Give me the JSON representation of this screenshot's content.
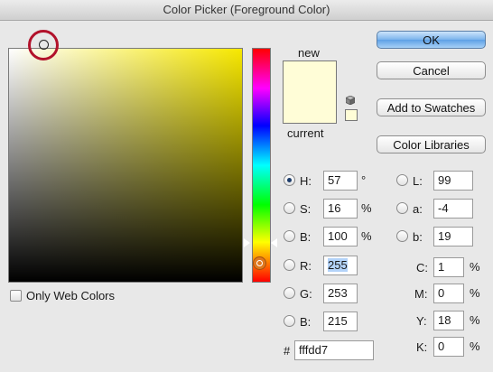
{
  "window": {
    "title": "Color Picker (Foreground Color)"
  },
  "swatches": {
    "new_label": "new",
    "current_label": "current",
    "new_color": "#fffdd7",
    "current_color": "#fffdd7"
  },
  "buttons": {
    "ok": "OK",
    "cancel": "Cancel",
    "add_to_swatches": "Add to Swatches",
    "color_libraries": "Color Libraries"
  },
  "only_web_colors": {
    "label": "Only Web Colors",
    "checked": false
  },
  "hsb": {
    "h": {
      "label": "H:",
      "value": "57",
      "unit": "°"
    },
    "s": {
      "label": "S:",
      "value": "16",
      "unit": "%"
    },
    "b": {
      "label": "B:",
      "value": "100",
      "unit": "%"
    }
  },
  "lab": {
    "l": {
      "label": "L:",
      "value": "99"
    },
    "a": {
      "label": "a:",
      "value": "-4"
    },
    "b": {
      "label": "b:",
      "value": "19"
    }
  },
  "rgb": {
    "r": {
      "label": "R:",
      "value": "255"
    },
    "g": {
      "label": "G:",
      "value": "253"
    },
    "b": {
      "label": "B:",
      "value": "215"
    }
  },
  "cmyk": {
    "c": {
      "label": "C:",
      "value": "1",
      "unit": "%"
    },
    "m": {
      "label": "M:",
      "value": "0",
      "unit": "%"
    },
    "y": {
      "label": "Y:",
      "value": "18",
      "unit": "%"
    },
    "k": {
      "label": "K:",
      "value": "0",
      "unit": "%"
    }
  },
  "hex": {
    "label": "#",
    "value": "fffdd7"
  }
}
